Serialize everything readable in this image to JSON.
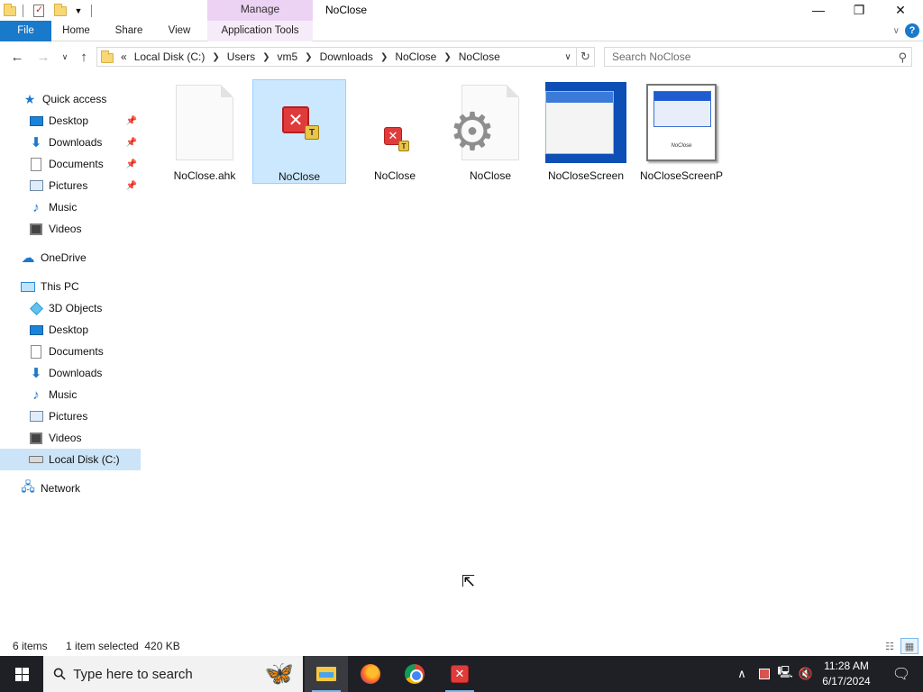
{
  "window": {
    "title": "NoClose",
    "context_tab": "Manage",
    "buttons": {
      "minimize": "—",
      "maximize": "❐",
      "close": "✕"
    }
  },
  "ribbon": {
    "tabs": [
      "File",
      "Home",
      "Share",
      "View",
      "Application Tools"
    ],
    "accent_color": "#1979ca",
    "context_color": "#ecd2f3"
  },
  "address": {
    "overflow": "«",
    "crumbs": [
      "Local Disk (C:)",
      "Users",
      "vm5",
      "Downloads",
      "NoClose",
      "NoClose"
    ]
  },
  "search": {
    "placeholder": "Search NoClose"
  },
  "navigation": {
    "quick_access": "Quick access",
    "quick_items": [
      {
        "label": "Desktop",
        "icon": "desktop-icon",
        "pinned": true
      },
      {
        "label": "Downloads",
        "icon": "download-icon",
        "pinned": true
      },
      {
        "label": "Documents",
        "icon": "documents-icon",
        "pinned": true
      },
      {
        "label": "Pictures",
        "icon": "pictures-icon",
        "pinned": true
      },
      {
        "label": "Music",
        "icon": "music-icon",
        "pinned": false
      },
      {
        "label": "Videos",
        "icon": "videos-icon",
        "pinned": false
      }
    ],
    "onedrive": "OneDrive",
    "this_pc": "This PC",
    "pc_items": [
      {
        "label": "3D Objects",
        "icon": "3d-objects-icon"
      },
      {
        "label": "Desktop",
        "icon": "desktop-icon"
      },
      {
        "label": "Documents",
        "icon": "documents-icon"
      },
      {
        "label": "Downloads",
        "icon": "download-icon"
      },
      {
        "label": "Music",
        "icon": "music-icon"
      },
      {
        "label": "Pictures",
        "icon": "pictures-icon"
      },
      {
        "label": "Videos",
        "icon": "videos-icon"
      },
      {
        "label": "Local Disk (C:)",
        "icon": "local-disk-icon",
        "selected": true
      }
    ],
    "network": "Network"
  },
  "files": [
    {
      "name": "NoClose.ahk",
      "icon": "blank-file-icon",
      "selected": false
    },
    {
      "name": "NoClose",
      "icon": "noclose-app-icon",
      "selected": true
    },
    {
      "name": "NoClose",
      "icon": "noclose-small-icon",
      "selected": false
    },
    {
      "name": "NoClose",
      "icon": "settings-file-icon",
      "selected": false
    },
    {
      "name": "NoCloseScreen",
      "icon": "screenshot-thumbnail",
      "selected": false
    },
    {
      "name": "NoCloseScreenP",
      "icon": "screenshot-thumbnail-2",
      "selected": false
    }
  ],
  "thumbnail_caption": "NoClose",
  "status": {
    "item_count": "6 items",
    "selection": "1 item selected  420 KB"
  },
  "taskbar": {
    "search_placeholder": "Type here to search",
    "apps": [
      "file-explorer-icon",
      "firefox-icon",
      "chrome-icon",
      "noclose-taskbar-icon"
    ],
    "time": "11:28 AM",
    "date": "6/17/2024"
  }
}
